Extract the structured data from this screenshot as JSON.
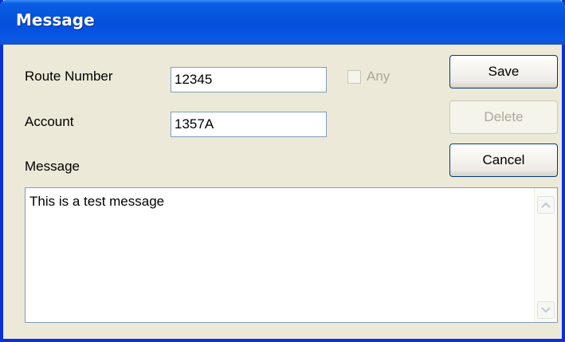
{
  "window": {
    "title": "Message"
  },
  "form": {
    "route_number_label": "Route Number",
    "route_number_value": "12345",
    "any_label": "Any",
    "any_checked": false,
    "account_label": "Account",
    "account_value": "1357A",
    "message_label": "Message",
    "message_value": "This is a test message"
  },
  "buttons": {
    "save_label": "Save",
    "delete_label": "Delete",
    "delete_enabled": false,
    "cancel_label": "Cancel"
  },
  "icons": {
    "scroll_up": "chevron-up-icon",
    "scroll_down": "chevron-down-icon"
  },
  "colors": {
    "titlebar": "#0553dc",
    "dialog_bg": "#ece9d8",
    "disabled_text": "#aca899"
  }
}
